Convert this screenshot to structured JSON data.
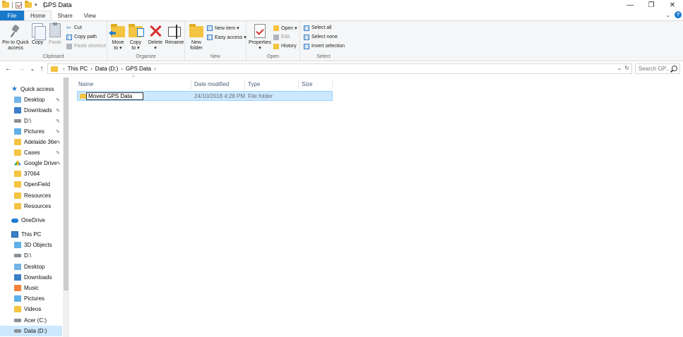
{
  "window": {
    "title": "GPS Data",
    "minimize": "—",
    "maximize": "❐",
    "close": "✕"
  },
  "tabs": [
    {
      "label": "File"
    },
    {
      "label": "Home"
    },
    {
      "label": "Share"
    },
    {
      "label": "View"
    }
  ],
  "ribbon": {
    "clipboard": {
      "label": "Clipboard",
      "pin_line1": "Pin to Quick",
      "pin_line2": "access",
      "copy": "Copy",
      "paste": "Paste",
      "cut": "Cut",
      "copy_path": "Copy path",
      "paste_shortcut": "Paste shortcut"
    },
    "organize": {
      "label": "Organize",
      "move_line1": "Move",
      "move_line2": "to ▾",
      "copy_line1": "Copy",
      "copy_line2": "to ▾",
      "delete": "Delete",
      "delete_caret": "▾",
      "rename": "Rename"
    },
    "new": {
      "label": "New",
      "new_folder_line1": "New",
      "new_folder_line2": "folder",
      "new_item": "New item ▾",
      "easy_access": "Easy access ▾"
    },
    "open": {
      "label": "Open",
      "properties": "Properties",
      "properties_caret": "▾",
      "open": "Open ▾",
      "edit": "Edit",
      "history": "History"
    },
    "select": {
      "label": "Select",
      "select_all": "Select all",
      "select_none": "Select none",
      "invert": "Invert selection"
    }
  },
  "navigation": {
    "back": "←",
    "forward": "→",
    "recent": "⌄",
    "up": "↑",
    "breadcrumb": [
      "This PC",
      "Data (D:)",
      "GPS Data"
    ],
    "dropdown": "⌄",
    "refresh": "↻",
    "search_placeholder": "Search GP..."
  },
  "sidebar": {
    "quick_access": "Quick access",
    "quick_items": [
      {
        "label": "Desktop",
        "pinned": "✎"
      },
      {
        "label": "Downloads",
        "pinned": "✎"
      },
      {
        "label": "D:\\",
        "pinned": "✎"
      },
      {
        "label": "Pictures",
        "pinned": "✎"
      },
      {
        "label": "Adelaide 36e",
        "pinned": "✎"
      },
      {
        "label": "Cases",
        "pinned": "✎"
      },
      {
        "label": "Google Drive",
        "pinned": "✎"
      },
      {
        "label": "37064"
      },
      {
        "label": "OpenField"
      },
      {
        "label": "Resources"
      },
      {
        "label": "Resources"
      }
    ],
    "onedrive": "OneDrive",
    "this_pc": "This PC",
    "pc_items": [
      {
        "label": "3D Objects"
      },
      {
        "label": "D:\\"
      },
      {
        "label": "Desktop"
      },
      {
        "label": "Downloads"
      },
      {
        "label": "Music"
      },
      {
        "label": "Pictures"
      },
      {
        "label": "Videos"
      },
      {
        "label": "Acer (C:)"
      },
      {
        "label": "Data (D:)"
      }
    ]
  },
  "filelist": {
    "sort_indicator": "^",
    "columns": [
      "Name",
      "Date modified",
      "Type",
      "Size"
    ],
    "rows": [
      {
        "name": "Moved GPS Data",
        "date": "24/10/2018 4:28 PM",
        "type": "File folder",
        "size": ""
      }
    ]
  }
}
